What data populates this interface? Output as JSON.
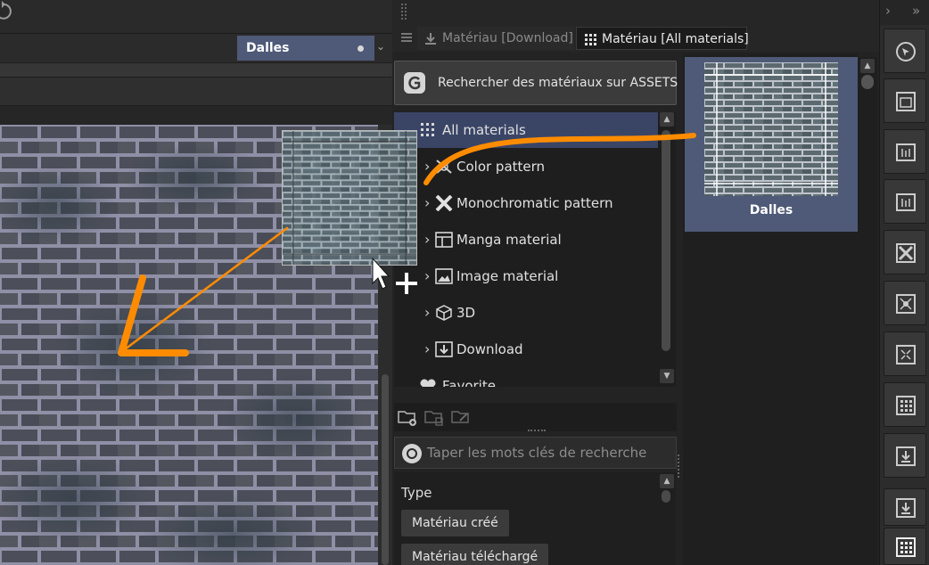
{
  "document_tab": {
    "label": "Dalles"
  },
  "material_palette": {
    "tabs": [
      {
        "label": "Matériau [Download]",
        "icon": "download-icon",
        "active": false
      },
      {
        "label": "Matériau [All materials]",
        "icon": "grid-dots-icon",
        "active": true
      }
    ],
    "assets_button": {
      "label": "Rechercher des matériaux sur ASSETS",
      "icon": "assets-logo-icon"
    },
    "tree": [
      {
        "label": "All materials",
        "icon": "grid-dots-icon",
        "selected": true
      },
      {
        "label": "Color pattern",
        "icon": "color-pattern-icon"
      },
      {
        "label": "Monochromatic pattern",
        "icon": "monochromatic-pattern-icon"
      },
      {
        "label": "Manga material",
        "icon": "manga-material-icon"
      },
      {
        "label": "Image material",
        "icon": "image-material-icon"
      },
      {
        "label": "3D",
        "icon": "cube-icon"
      },
      {
        "label": "Download",
        "icon": "download-folder-icon"
      },
      {
        "label": "Favorite",
        "icon": "heart-icon"
      }
    ],
    "search": {
      "placeholder": "Taper les mots clés de recherche"
    },
    "filter": {
      "type_label": "Type",
      "chips": [
        "Matériau créé",
        "Matériau téléchargé"
      ]
    },
    "results": [
      {
        "label": "Dalles"
      }
    ]
  },
  "colors": {
    "accent_selection": "#4e5a77",
    "tree_selection": "#3a4566",
    "annotation_orange": "#ff8c00",
    "brick": "#4c4f59",
    "mortar": "#8f8fa6"
  }
}
